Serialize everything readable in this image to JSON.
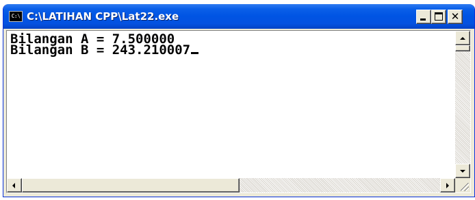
{
  "window": {
    "title": "C:\\LATIHAN CPP\\Lat22.exe",
    "icon_text": "C:\\"
  },
  "title_buttons": {
    "minimize_icon": "minimize-icon",
    "maximize_icon": "maximize-icon",
    "close_glyph": "✕"
  },
  "console": {
    "lines": [
      "Bilangan A = 7.500000",
      "Bilangan B = 243.210007"
    ]
  },
  "colors": {
    "titlebar": "#0054e3",
    "frame": "#ece9d8",
    "console_bg": "#ffffff",
    "console_text": "#000000"
  }
}
